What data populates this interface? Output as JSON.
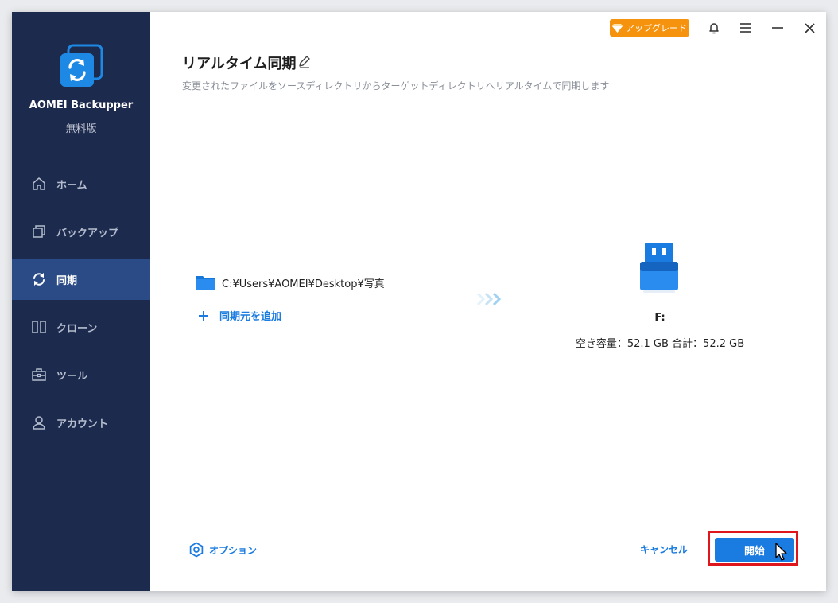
{
  "app": {
    "name": "AOMEI Backupper",
    "edition": "無料版"
  },
  "titlebar": {
    "upgrade_label": "アップグレード",
    "icons": [
      "bell-icon",
      "menu-icon",
      "minimize-icon",
      "close-icon"
    ]
  },
  "sidebar": {
    "items": [
      {
        "label": "ホーム",
        "icon": "home-icon",
        "active": false
      },
      {
        "label": "バックアップ",
        "icon": "backup-icon",
        "active": false
      },
      {
        "label": "同期",
        "icon": "sync-icon",
        "active": true
      },
      {
        "label": "クローン",
        "icon": "clone-icon",
        "active": false
      },
      {
        "label": "ツール",
        "icon": "tools-icon",
        "active": false
      },
      {
        "label": "アカウント",
        "icon": "account-icon",
        "active": false
      }
    ]
  },
  "main": {
    "title": "リアルタイム同期",
    "description": "変更されたファイルをソースディレクトリからターゲットディレクトリへリアルタイムで同期します",
    "source_path": "C:¥Users¥AOMEI¥Desktop¥写真",
    "add_source_label": "同期元を追加",
    "target": {
      "drive_letter": "F:",
      "info": "空き容量：52.1 GB 合計：52.2 GB"
    }
  },
  "footer": {
    "option_label": "オプション",
    "cancel_label": "キャンセル",
    "start_label": "開始"
  },
  "colors": {
    "sidebar_bg": "#1c2a4d",
    "sidebar_active": "#2b4b87",
    "accent": "#1a7be0",
    "upgrade": "#f5930f",
    "highlight_frame": "#e0161d"
  }
}
